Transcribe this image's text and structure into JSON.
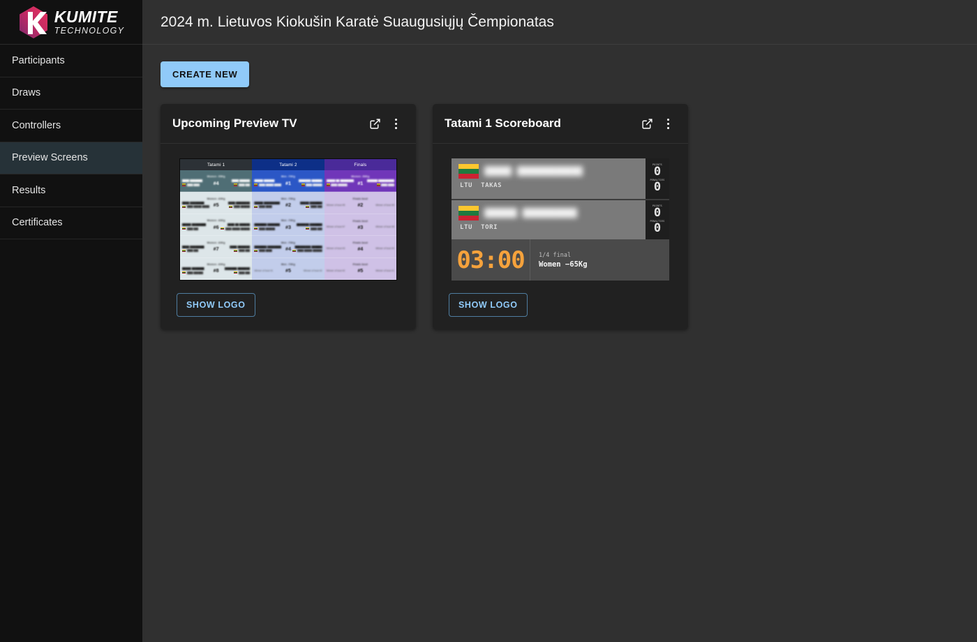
{
  "brand": {
    "name": "KUMITE",
    "subtitle": "TECHNOLOGY",
    "logo_icon": "hexagon-k-logo"
  },
  "sidebar": {
    "items": [
      {
        "label": "Participants",
        "active": false
      },
      {
        "label": "Draws",
        "active": false
      },
      {
        "label": "Controllers",
        "active": false
      },
      {
        "label": "Preview Screens",
        "active": true
      },
      {
        "label": "Results",
        "active": false
      },
      {
        "label": "Certificates",
        "active": false
      }
    ]
  },
  "header": {
    "title": "2024 m. Lietuvos Kiokušin Karatė Suaugusiųjų Čempionatas"
  },
  "toolbar": {
    "create_label": "CREATE NEW"
  },
  "colors": {
    "accent_blue": "#90caf9",
    "page_bg": "#303030",
    "sidebar_bg": "#111111",
    "card_bg": "#212121",
    "active_nav": "#263238",
    "timer_orange": "#f5a23c"
  },
  "cards": [
    {
      "title": "Upcoming Preview TV",
      "open_icon": "external-link-icon",
      "menu_icon": "kebab-menu-icon",
      "show_logo_label": "SHOW LOGO",
      "preview_type": "upcoming-tv"
    },
    {
      "title": "Tatami 1 Scoreboard",
      "open_icon": "external-link-icon",
      "menu_icon": "kebab-menu-icon",
      "show_logo_label": "SHOW LOGO",
      "preview_type": "scoreboard"
    }
  ],
  "preview_tv": {
    "columns": [
      {
        "header": "Tatami 1",
        "rows": [
          {
            "category": "Women -55Kg",
            "number": "#4",
            "left_name": "████ ███████",
            "left_club": "████ ████",
            "right_name": "████ ██████",
            "right_club": "████ ███",
            "placeholder": false
          },
          {
            "category": "Women -60Kg",
            "number": "#5",
            "left_name": "████ ████████",
            "left_club": "████ █████ ██████",
            "right_name": "████ ████████",
            "right_club": "████ ██████",
            "placeholder": false
          },
          {
            "category": "Women -60Kg",
            "number": "#6",
            "left_name": "█████ ████████",
            "left_club": "████ ███",
            "right_name": "████ ██ ██████",
            "right_club": "████ █████ ██████",
            "placeholder": false
          },
          {
            "category": "Women -60Kg",
            "number": "#7",
            "left_name": "████ ████████",
            "left_club": "████ ███",
            "right_name": "████ ███████",
            "right_club": "████ ███",
            "placeholder": false
          },
          {
            "category": "Women -60Kg",
            "number": "#8",
            "left_name": "█████ ███████",
            "left_club": "████ ██████",
            "right_name": "███████ ███████",
            "right_club": "████ ███",
            "placeholder": false
          }
        ]
      },
      {
        "header": "Tatami 2",
        "rows": [
          {
            "category": "Men -70Kg",
            "number": "#1",
            "left_name": "█████ ██████",
            "left_club": "████ █████ █████",
            "right_name": "███████ ██████",
            "right_club": "████ ██████",
            "placeholder": false
          },
          {
            "category": "Men -70Kg",
            "number": "#2",
            "left_name": "█████ █████████",
            "left_club": "████ ████",
            "right_name": "█████ ███████",
            "right_club": "████ ███",
            "placeholder": false
          },
          {
            "category": "Men -70Kg",
            "number": "#3",
            "left_name": "███████ ███████",
            "left_club": "████ ██████",
            "right_name": "███████ ███████",
            "right_club": "████ ███",
            "placeholder": false
          },
          {
            "category": "Men -70Kg",
            "number": "#4",
            "left_name": "███████ ████████",
            "left_club": "████ ████",
            "right_name": "█████████ ██████",
            "right_club": "████ █████ ██████",
            "placeholder": false
          },
          {
            "category": "Men -70Kg",
            "number": "#5",
            "left_placeholder": "Winner of bout #1",
            "right_placeholder": "Winner of bout #2",
            "placeholder": true
          }
        ]
      },
      {
        "header": "Finals",
        "rows": [
          {
            "category": "Women -50Kg",
            "number": "#1",
            "left_name": "█████ ██ ██████████",
            "left_club": "████ ██████",
            "right_name": "██████ █████████",
            "right_club": "████ ████",
            "placeholder": false
          },
          {
            "category": "Finals bout",
            "number": "#2",
            "left_placeholder": "Winner of bout #5",
            "right_placeholder": "Winner of bout #6",
            "placeholder": true
          },
          {
            "category": "Finals bout",
            "number": "#3",
            "left_placeholder": "Winner of bout #7",
            "right_placeholder": "Winner of bout #8",
            "placeholder": true
          },
          {
            "category": "Finals bout",
            "number": "#4",
            "left_placeholder": "Winner of bout #3",
            "right_placeholder": "Winner of bout #4",
            "placeholder": true
          },
          {
            "category": "Finals bout",
            "number": "#5",
            "left_placeholder": "Winner of bout #2",
            "right_placeholder": "Winner of bout #1",
            "placeholder": true
          }
        ]
      }
    ]
  },
  "scoreboard": {
    "fighters": [
      {
        "flag": "lithuania-flag-icon",
        "country": "LTU",
        "position": "TAKAS",
        "name": "█████ ████████████",
        "score_label_1": "POINTS",
        "score_1": "0",
        "score_label_2": "PENALTIES",
        "score_2": "0"
      },
      {
        "flag": "lithuania-flag-icon",
        "country": "LTU",
        "position": "TORI",
        "name": "██████ ██████████",
        "score_label_1": "POINTS",
        "score_1": "0",
        "score_label_2": "PENALTIES",
        "score_2": "0"
      }
    ],
    "timer": "03:00",
    "round": "1/4 final",
    "category": "Women −65Kg"
  }
}
